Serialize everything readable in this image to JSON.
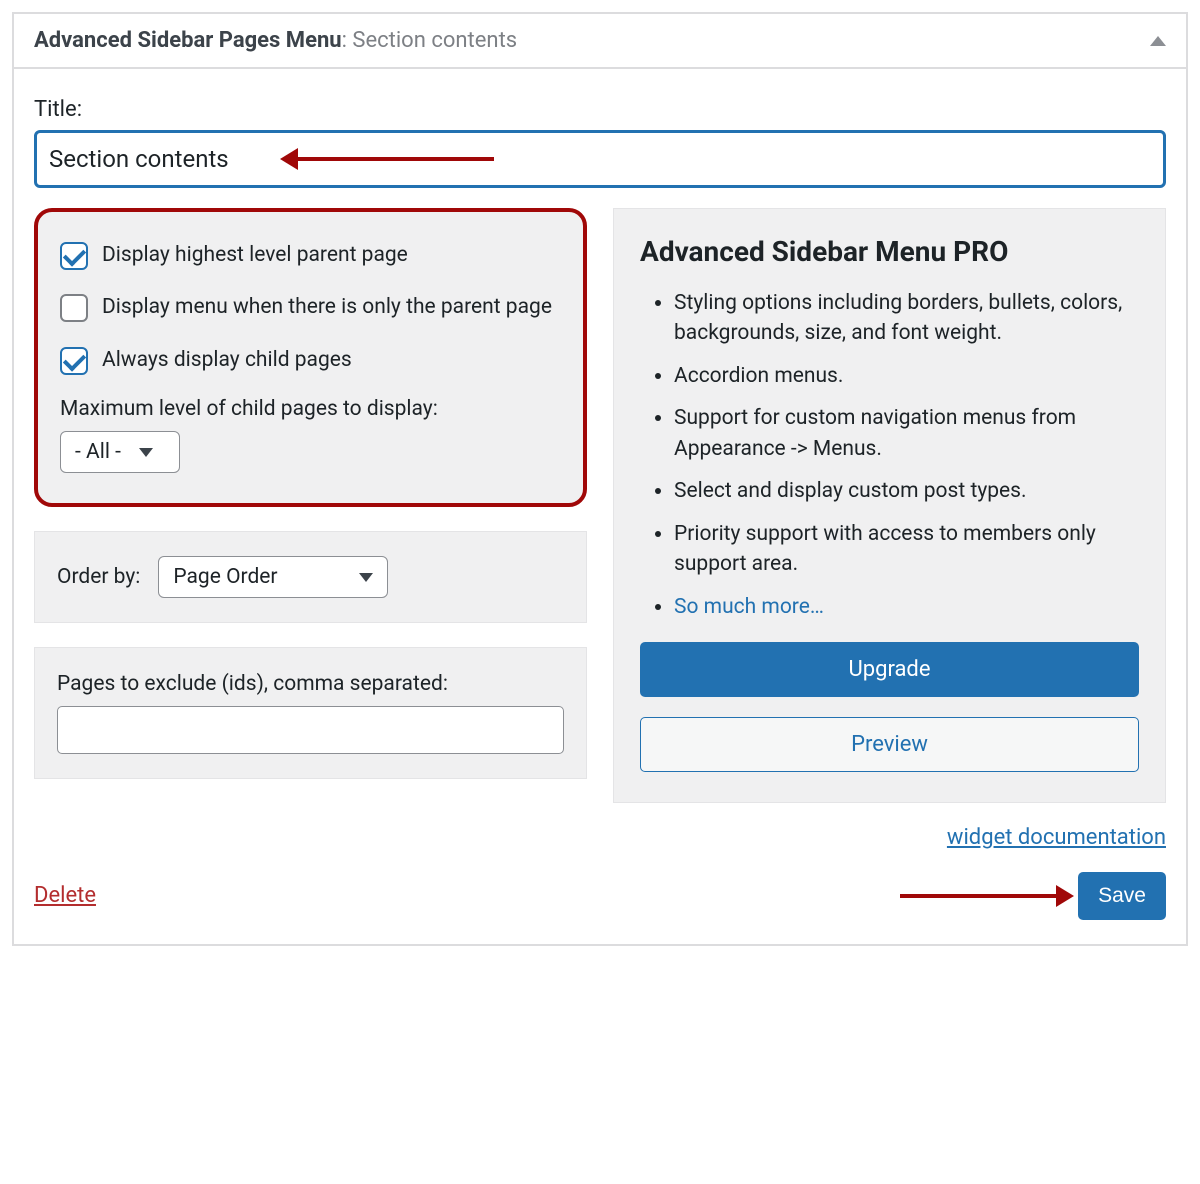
{
  "header": {
    "title_bold": "Advanced Sidebar Pages Menu",
    "title_thin": ": Section contents"
  },
  "title": {
    "label": "Title:",
    "value": "Section contents"
  },
  "options": {
    "display_highest_parent": {
      "label": "Display highest level parent page",
      "checked": true
    },
    "display_when_only_parent": {
      "label": "Display menu when there is only the parent page",
      "checked": false
    },
    "always_display_child": {
      "label": "Always display child pages",
      "checked": true
    },
    "max_level_label": "Maximum level of child pages to display:",
    "max_level_value": "- All -"
  },
  "order": {
    "label": "Order by:",
    "value": "Page Order"
  },
  "exclude": {
    "label": "Pages to exclude (ids), comma separated:",
    "value": ""
  },
  "pro": {
    "title": "Advanced Sidebar Menu PRO",
    "items": [
      "Styling options including borders, bullets, colors, backgrounds, size, and font weight.",
      "Accordion menus.",
      "Support for custom navigation menus from Appearance -> Menus.",
      "Select and display custom post types.",
      "Priority support with access to members only support area."
    ],
    "more_link": "So much more…",
    "upgrade": "Upgrade",
    "preview": "Preview"
  },
  "footer": {
    "doc_link": "widget documentation",
    "delete": "Delete",
    "save": "Save"
  }
}
